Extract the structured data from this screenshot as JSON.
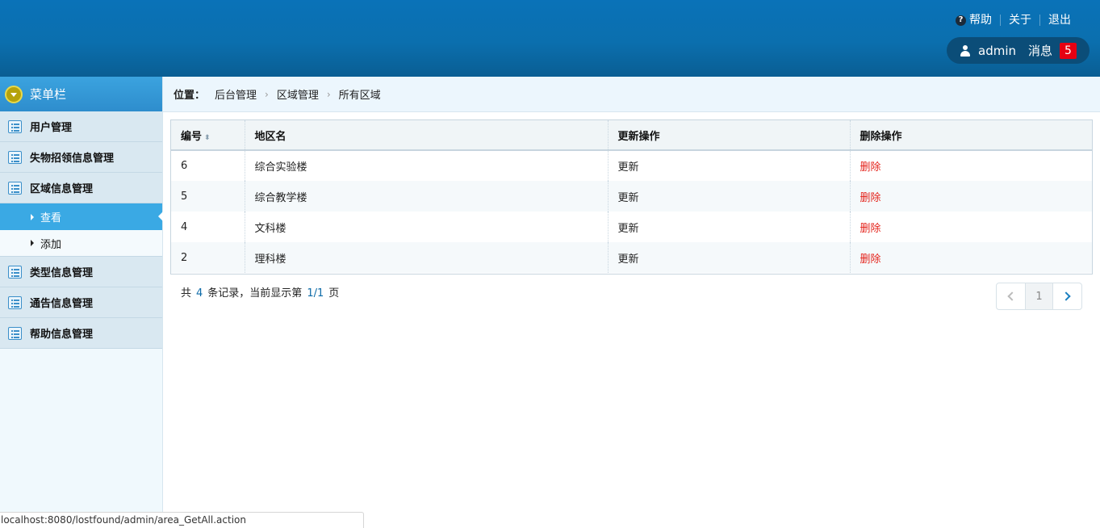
{
  "header": {
    "links": {
      "help": "帮助",
      "about": "关于",
      "logout": "退出"
    },
    "user": {
      "name": "admin",
      "messages_label": "消息",
      "message_count": "5"
    }
  },
  "sidebar": {
    "title": "菜单栏",
    "groups": [
      {
        "label": "用户管理"
      },
      {
        "label": "失物招领信息管理"
      },
      {
        "label": "区域信息管理",
        "children": [
          {
            "label": "查看",
            "active": true
          },
          {
            "label": "添加"
          }
        ]
      },
      {
        "label": "类型信息管理"
      },
      {
        "label": "通告信息管理"
      },
      {
        "label": "帮助信息管理"
      }
    ]
  },
  "breadcrumb": {
    "label": "位置：",
    "items": [
      "后台管理",
      "区域管理",
      "所有区域"
    ]
  },
  "table": {
    "headers": [
      "编号",
      "地区名",
      "更新操作",
      "删除操作"
    ],
    "rows": [
      {
        "id": "6",
        "name": "综合实验楼",
        "update": "更新",
        "delete": "删除"
      },
      {
        "id": "5",
        "name": "综合教学楼",
        "update": "更新",
        "delete": "删除"
      },
      {
        "id": "4",
        "name": "文科楼",
        "update": "更新",
        "delete": "删除"
      },
      {
        "id": "2",
        "name": "理科楼",
        "update": "更新",
        "delete": "删除"
      }
    ]
  },
  "footer": {
    "prefix": "共",
    "total": "4",
    "mid": "条记录，当前显示第",
    "page": "1/1",
    "suffix": "页",
    "current_page": "1"
  },
  "status_bar": {
    "url": "localhost:8080/lostfound/admin/area_GetAll.action"
  },
  "colors": {
    "header": "#0a72b8",
    "active_menu": "#3aa9e4",
    "delete_link": "#e4231b",
    "badge": "#e60012"
  }
}
